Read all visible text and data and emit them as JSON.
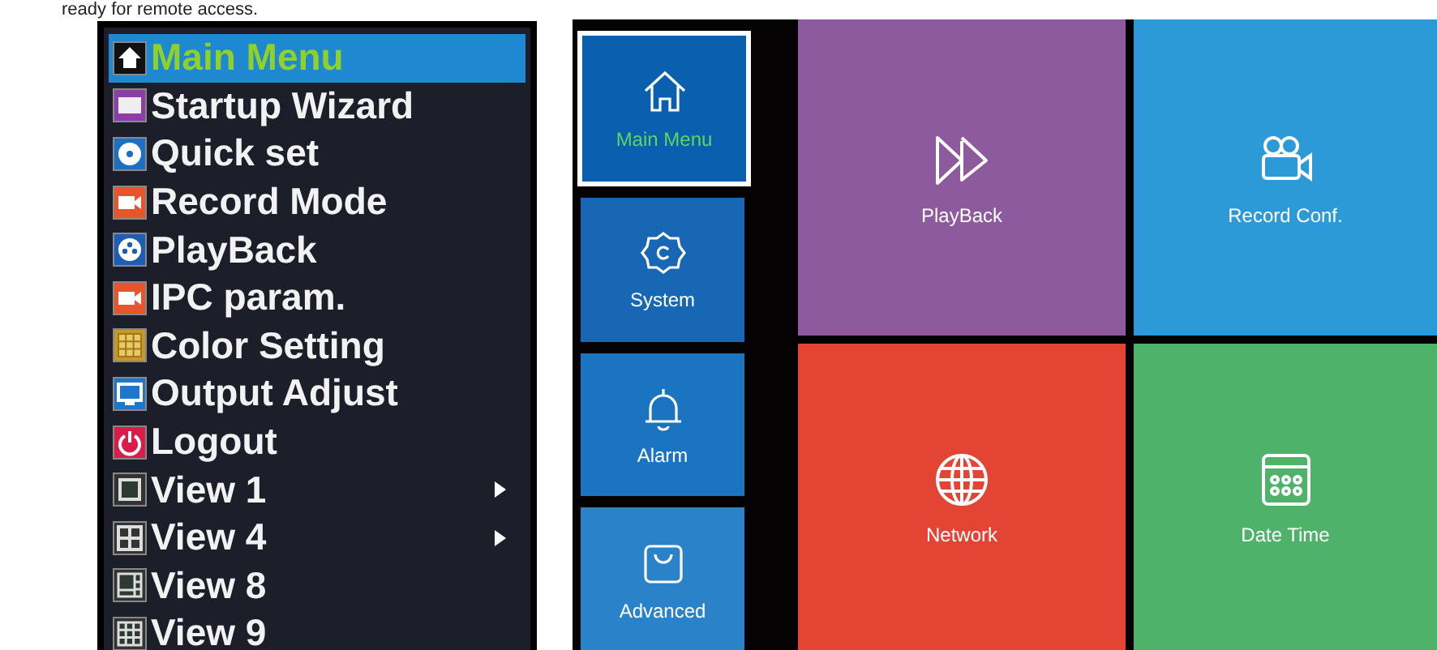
{
  "caption": "ready for remote access.",
  "menu": {
    "items": [
      {
        "label": "Main Menu",
        "selected": true,
        "submenu": false
      },
      {
        "label": "Startup Wizard",
        "selected": false,
        "submenu": false
      },
      {
        "label": "Quick set",
        "selected": false,
        "submenu": false
      },
      {
        "label": "Record Mode",
        "selected": false,
        "submenu": false
      },
      {
        "label": "PlayBack",
        "selected": false,
        "submenu": false
      },
      {
        "label": "IPC param.",
        "selected": false,
        "submenu": false
      },
      {
        "label": "Color Setting",
        "selected": false,
        "submenu": false
      },
      {
        "label": "Output Adjust",
        "selected": false,
        "submenu": false
      },
      {
        "label": "Logout",
        "selected": false,
        "submenu": false
      },
      {
        "label": "View 1",
        "selected": false,
        "submenu": true
      },
      {
        "label": "View 4",
        "selected": false,
        "submenu": true
      },
      {
        "label": "View 8",
        "selected": false,
        "submenu": false
      },
      {
        "label": "View 9",
        "selected": false,
        "submenu": false
      }
    ]
  },
  "sidebar": {
    "items": [
      {
        "label": "Main Menu",
        "selected": true
      },
      {
        "label": "System",
        "selected": false
      },
      {
        "label": "Alarm",
        "selected": false
      },
      {
        "label": "Advanced",
        "selected": false
      }
    ]
  },
  "tiles": [
    {
      "label": "PlayBack",
      "color": "#8e5a9e"
    },
    {
      "label": "Record Conf.",
      "color": "#2d9ad8"
    },
    {
      "label": "Network",
      "color": "#e34434"
    },
    {
      "label": "Date Time",
      "color": "#4fb26a"
    }
  ]
}
